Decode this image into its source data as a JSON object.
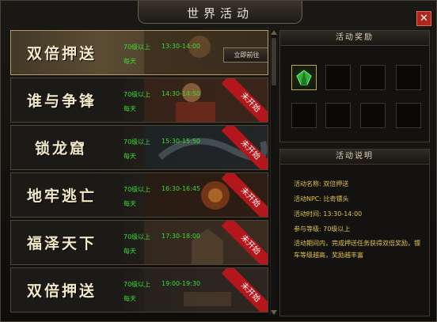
{
  "window": {
    "title": "世界活动"
  },
  "activities": [
    {
      "name": "双倍押送",
      "level": "70级以上",
      "time": "13:30-14:00",
      "frequency": "每天",
      "button": "立即前往",
      "status": ""
    },
    {
      "name": "谁与争锋",
      "level": "70级以上",
      "time": "14:30-14:50",
      "frequency": "每天",
      "button": "",
      "status": "未开始"
    },
    {
      "name": "锁龙窟",
      "level": "70级以上",
      "time": "15:30-15:50",
      "frequency": "每天",
      "button": "",
      "status": "未开始"
    },
    {
      "name": "地牢逃亡",
      "level": "70级以上",
      "time": "16:30-16:45",
      "frequency": "每天",
      "button": "",
      "status": "未开始"
    },
    {
      "name": "福泽天下",
      "level": "70级以上",
      "time": "17:30-18:00",
      "frequency": "每天",
      "button": "",
      "status": "未开始"
    },
    {
      "name": "双倍押送",
      "level": "70级以上",
      "time": "19:00-19:30",
      "frequency": "每天",
      "button": "",
      "status": "未开始"
    }
  ],
  "rewards": {
    "title": "活动奖励"
  },
  "description": {
    "title": "活动说明",
    "lines": [
      {
        "label": "活动名称:",
        "value": "双倍押送"
      },
      {
        "label": "活动NPC:",
        "value": "比奇镖头"
      },
      {
        "label": "活动时间:",
        "value": "13:30-14:00"
      },
      {
        "label": "参与等级:",
        "value": "70级以上"
      }
    ],
    "text": "活动期间内，完成押送任务获得双倍奖励，镖车等级越高，奖励越丰富"
  },
  "colors": {
    "accent_green": "#3adc2f",
    "ribbon_red": "#b3161b",
    "desc_yellow": "#e0c24a"
  }
}
